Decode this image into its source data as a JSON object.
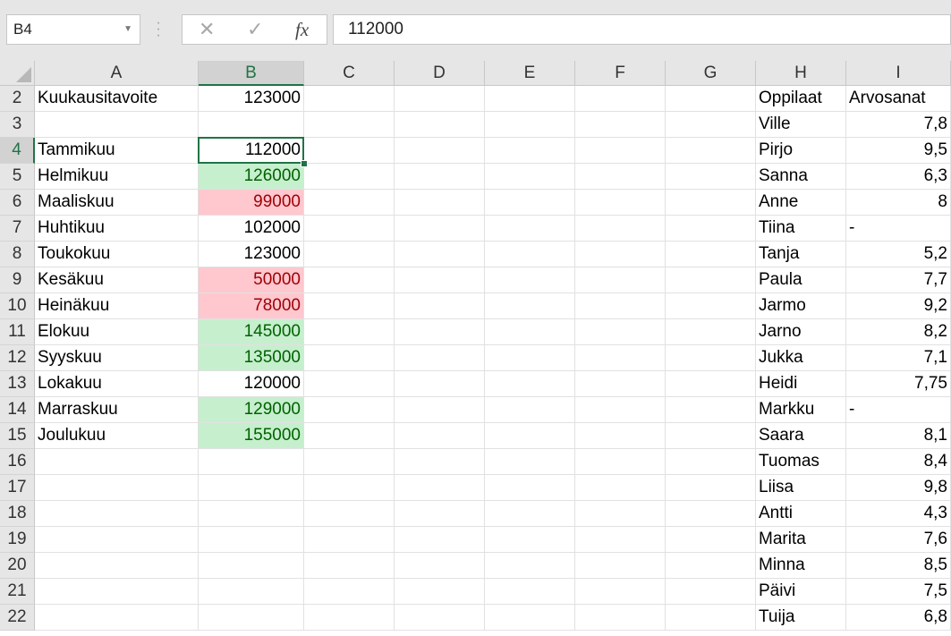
{
  "name_box": "B4",
  "formula_bar": {
    "cancel_glyph": "✕",
    "enter_glyph": "✓",
    "fx_label": "fx",
    "value": "112000"
  },
  "columns": [
    "A",
    "B",
    "C",
    "D",
    "E",
    "F",
    "G",
    "H",
    "I"
  ],
  "selected_column": "B",
  "rows": [
    {
      "n": "2",
      "A": "Kuukausitavoite",
      "B": "123000",
      "H": "Oppilaat",
      "I": "Arvosanat"
    },
    {
      "n": "3",
      "A": "",
      "B": "",
      "H": "Ville",
      "I": "7,8"
    },
    {
      "n": "4",
      "A": "Tammikuu",
      "B": "112000",
      "H": "Pirjo",
      "I": "9,5"
    },
    {
      "n": "5",
      "A": "Helmikuu",
      "B": "126000",
      "H": "Sanna",
      "I": "6,3"
    },
    {
      "n": "6",
      "A": "Maaliskuu",
      "B": "99000",
      "H": "Anne",
      "I": "8"
    },
    {
      "n": "7",
      "A": "Huhtikuu",
      "B": "102000",
      "H": "Tiina",
      "I": "-"
    },
    {
      "n": "8",
      "A": "Toukokuu",
      "B": "123000",
      "H": "Tanja",
      "I": "5,2"
    },
    {
      "n": "9",
      "A": "Kesäkuu",
      "B": "50000",
      "H": "Paula",
      "I": "7,7"
    },
    {
      "n": "10",
      "A": "Heinäkuu",
      "B": "78000",
      "H": "Jarmo",
      "I": "9,2"
    },
    {
      "n": "11",
      "A": "Elokuu",
      "B": "145000",
      "H": "Jarno",
      "I": "8,2"
    },
    {
      "n": "12",
      "A": "Syyskuu",
      "B": "135000",
      "H": "Jukka",
      "I": "7,1"
    },
    {
      "n": "13",
      "A": "Lokakuu",
      "B": "120000",
      "H": "Heidi",
      "I": "7,75"
    },
    {
      "n": "14",
      "A": "Marraskuu",
      "B": "129000",
      "H": "Markku",
      "I": "-"
    },
    {
      "n": "15",
      "A": "Joulukuu",
      "B": "155000",
      "H": "Saara",
      "I": "8,1"
    },
    {
      "n": "16",
      "A": "",
      "B": "",
      "H": "Tuomas",
      "I": "8,4"
    },
    {
      "n": "17",
      "A": "",
      "B": "",
      "H": "Liisa",
      "I": "9,8"
    },
    {
      "n": "18",
      "A": "",
      "B": "",
      "H": "Antti",
      "I": "4,3"
    },
    {
      "n": "19",
      "A": "",
      "B": "",
      "H": "Marita",
      "I": "7,6"
    },
    {
      "n": "20",
      "A": "",
      "B": "",
      "H": "Minna",
      "I": "8,5"
    },
    {
      "n": "21",
      "A": "",
      "B": "",
      "H": "Päivi",
      "I": "7,5"
    },
    {
      "n": "22",
      "A": "",
      "B": "",
      "H": "Tuija",
      "I": "6,8"
    }
  ],
  "conditional_format": {
    "B5": "green",
    "B6": "red",
    "B9": "red",
    "B10": "red",
    "B11": "green",
    "B12": "green",
    "B14": "green",
    "B15": "green"
  },
  "colors": {
    "selection_accent": "#217346",
    "good_fill": "#c6efce",
    "good_text": "#006100",
    "bad_fill": "#ffc7ce",
    "bad_text": "#9c0006"
  }
}
